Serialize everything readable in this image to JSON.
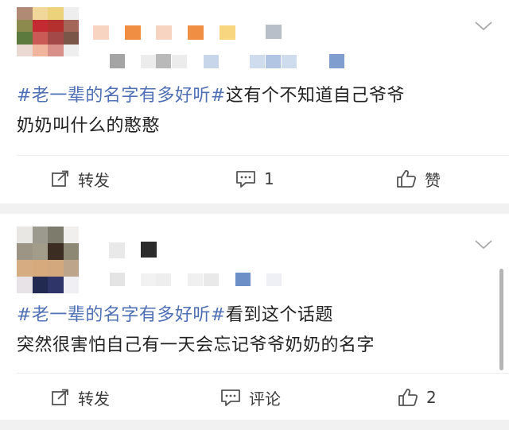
{
  "colors": {
    "hashtag": "#4f6fb5",
    "text": "#222222",
    "action_text": "#3c3c3c",
    "separator": "#f1f1f1",
    "icon": "#555555"
  },
  "posts": [
    {
      "hashtag": "#老一辈的名字有多好听#",
      "line1_rest": "这有个不知道自己爷爷",
      "line2": "奶奶叫什么的憨憨",
      "actions": {
        "repost_icon": "share-edit-icon",
        "repost_label": "转发",
        "comment_icon": "comment-icon",
        "comment_label": "1",
        "like_icon": "thumbs-up-icon",
        "like_label": "赞"
      }
    },
    {
      "hashtag": "#老一辈的名字有多好听#",
      "line1_rest": "看到这个话题",
      "line2": "突然很害怕自己有一天会忘记爷爷奶奶的名字",
      "actions": {
        "repost_icon": "share-edit-icon",
        "repost_label": "转发",
        "comment_icon": "comment-icon",
        "comment_label": "评论",
        "like_icon": "thumbs-up-icon",
        "like_label": "2"
      }
    }
  ]
}
